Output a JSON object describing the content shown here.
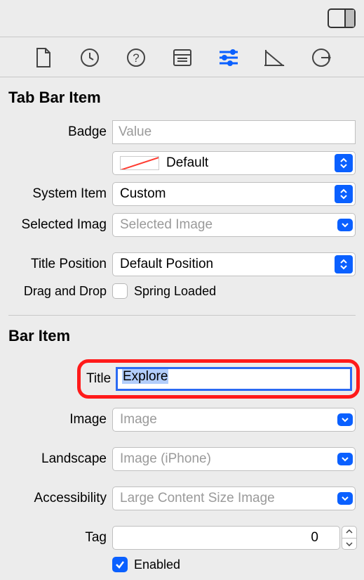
{
  "tabBarItem": {
    "header": "Tab Bar Item",
    "badge": {
      "label": "Badge",
      "placeholder": "Value"
    },
    "imageCombo": {
      "value": "Default"
    },
    "systemItem": {
      "label": "System Item",
      "value": "Custom"
    },
    "selectedImage": {
      "label": "Selected Imag",
      "placeholder": "Selected Image"
    },
    "titlePosition": {
      "label": "Title Position",
      "value": "Default Position"
    },
    "dragAndDrop": {
      "label": "Drag and Drop",
      "springLoaded": "Spring Loaded",
      "checked": false
    }
  },
  "barItem": {
    "header": "Bar Item",
    "title": {
      "label": "Title",
      "value": "Explore"
    },
    "image": {
      "label": "Image",
      "placeholder": "Image"
    },
    "landscape": {
      "label": "Landscape",
      "placeholder": "Image (iPhone)"
    },
    "accessibility": {
      "label": "Accessibility",
      "placeholder": "Large Content Size Image"
    },
    "tag": {
      "label": "Tag",
      "value": "0"
    },
    "enabled": {
      "label": "Enabled",
      "checked": true
    }
  }
}
